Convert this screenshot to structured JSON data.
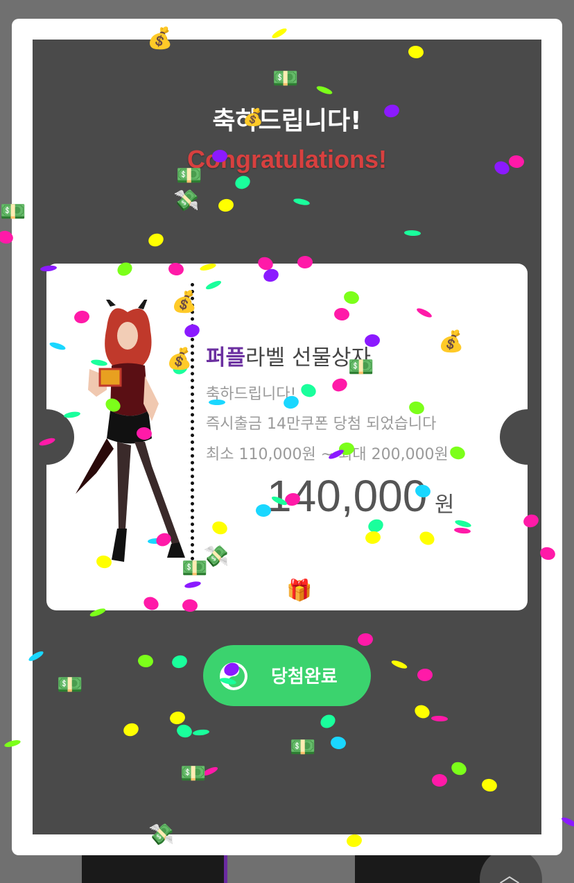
{
  "modal": {
    "heading": "축하드립니다!",
    "subheading": "Congratulations!"
  },
  "ticket": {
    "brand": "퍼플",
    "title_rest": "라벨 선물상자",
    "line1": "축하드립니다!",
    "line2": "즉시출금 14만쿠폰 당첨 되었습니다",
    "line3": "최소 110,000원 ~ 최대 200,000원",
    "amount": "140,000",
    "amount_unit": "원"
  },
  "button": {
    "label": "당첨완료"
  },
  "colors": {
    "stage": "#4a4a4a",
    "brand": "#6b2fa0",
    "congrats": "#d8403f",
    "button": "#3bd36e",
    "confetti": [
      "#ffff00",
      "#ff1aa8",
      "#8b1aff",
      "#1aff9c",
      "#1ad7ff",
      "#7cff1a"
    ]
  },
  "icons": [
    "money-bag-icon",
    "money-with-wings-icon",
    "banknote-icon",
    "gift-icon",
    "scroll-top-icon"
  ]
}
